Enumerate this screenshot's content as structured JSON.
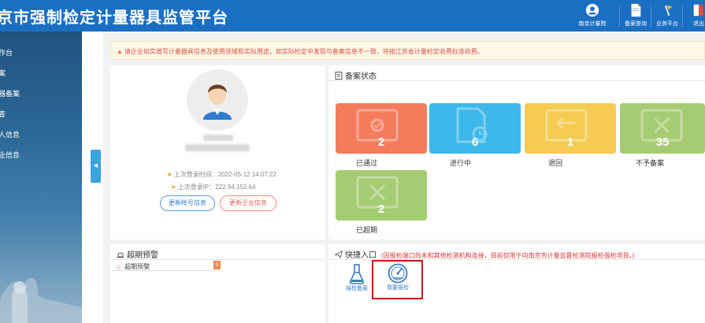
{
  "header": {
    "title": "京市强制检定计量器具监管平台",
    "nav": [
      {
        "label": "南京计量院",
        "icon": "avatar-icon"
      },
      {
        "label": "备案查询",
        "icon": "document-icon"
      },
      {
        "label": "业务平台",
        "icon": "flag-icon"
      },
      {
        "label": "退出",
        "icon": "logout-icon"
      }
    ]
  },
  "sidebar": {
    "items": [
      {
        "label": "作台"
      },
      {
        "label": "案"
      },
      {
        "label": "器备案"
      },
      {
        "label": "查"
      },
      {
        "label": "人信息"
      },
      {
        "label": "业信息"
      }
    ]
  },
  "notice": {
    "text": "请企业如实填写计量器具信息及使用领域和实际用途，如实际检定中发现与备案信息不一致，将按江苏省计量检定收费标准收费。"
  },
  "profile": {
    "last_login_time": "上次登录时间：2022-05-12 14:07:22",
    "last_login_ip": "上次登录IP：222.94.152.64",
    "update_account_label": "更新帐号信息",
    "update_company_label": "更新企业信息"
  },
  "status": {
    "title": "备案状态",
    "tiles": [
      {
        "label": "已通过",
        "count": "2",
        "color": "#f47c5c"
      },
      {
        "label": "进行中",
        "count": "6",
        "color": "#3cb8ea"
      },
      {
        "label": "退回",
        "count": "1",
        "color": "#f5cb54"
      },
      {
        "label": "不予备案",
        "count": "35",
        "color": "#a5cc72"
      },
      {
        "label": "已超期",
        "count": "2",
        "color": "#a5cc72"
      }
    ]
  },
  "warnings": {
    "title": "超期预警",
    "row_label": "超期预警",
    "count": "0"
  },
  "quick": {
    "title": "快捷入口",
    "note": "(因报检端口尚未和其他检测机构连接，目前仅限于向南京市计量监督检测院报检强检项目。)",
    "items": [
      {
        "label": "报检备案",
        "icon": "flask-icon"
      },
      {
        "label": "我要报检",
        "icon": "gauge-icon"
      }
    ]
  }
}
